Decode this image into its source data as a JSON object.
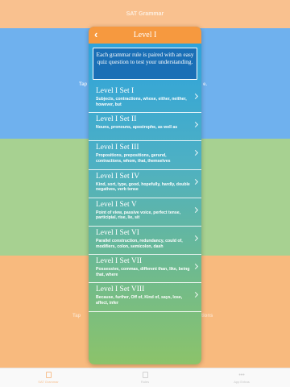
{
  "background": {
    "app_title": "SAT Grammar",
    "tap_text_top_left": "Tap",
    "tap_text_top_right": "e.",
    "tap_text_bottom_left": "Tap",
    "tap_text_bottom_right": "tions",
    "tabs": [
      {
        "label": "SAT Grammar",
        "icon": "book-icon"
      },
      {
        "label": "Rules",
        "icon": "document-icon"
      },
      {
        "label": "App Extras",
        "icon": "more-icon"
      }
    ]
  },
  "modal": {
    "title": "Level I",
    "back_glyph": "‹",
    "intro": "Each grammar rule is paired with an easy quiz question to test your understanding.",
    "items": [
      {
        "title": "Level I Set I",
        "subtitle": "Subjects, contractions, whose, either, neither, however, but"
      },
      {
        "title": "Level I Set II",
        "subtitle": "Nouns, pronouns, apostrophe, as well as"
      },
      {
        "title": "Level I Set III",
        "subtitle": "Propositions, prepositions, gerund, contractions, whom, that, themselves"
      },
      {
        "title": "Level I Set IV",
        "subtitle": "Kind, sort, type, good, hopefully, hardly, double negatives, verb tense"
      },
      {
        "title": "Level I Set V",
        "subtitle": "Point of view, passive voice, perfect tense, participial, rise, lie, sit"
      },
      {
        "title": "Level I Set VI",
        "subtitle": "Parallel construction, redundancy, could of, modifiers, colon, semicolon, dash"
      },
      {
        "title": "Level I Set VII",
        "subtitle": "Possessive, commas, different than, like, being that, where"
      },
      {
        "title": "Level I Set VIII",
        "subtitle": "Because, further, Off of, Kind of, says, lose, affect, infer"
      }
    ]
  },
  "colors": {
    "header_orange": "#f6993f",
    "band_blue": "#2c8de6",
    "band_green": "#7ebb5e",
    "band_orange": "#f59a42"
  }
}
